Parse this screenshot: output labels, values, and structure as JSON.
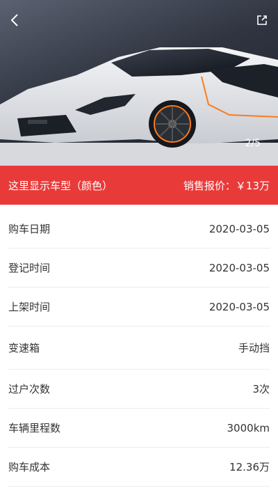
{
  "header": {
    "image_counter": "2/5",
    "back_icon": "chevron-left-icon",
    "share_icon": "share-icon"
  },
  "price_bar": {
    "model_text": "这里显示车型（颜色）",
    "price_label": "销售报价：",
    "price_value": "￥13万",
    "color": "#e93a3a"
  },
  "details": [
    {
      "label": "购车日期",
      "value": "2020-03-05"
    },
    {
      "label": "登记时间",
      "value": "2020-03-05"
    },
    {
      "label": "上架时间",
      "value": "2020-03-05"
    },
    {
      "label": "变速箱",
      "value": "手动挡"
    },
    {
      "label": "过户次数",
      "value": "3次"
    },
    {
      "label": "车辆里程数",
      "value": "3000km"
    },
    {
      "label": "购车成本",
      "value": "12.36万"
    }
  ]
}
